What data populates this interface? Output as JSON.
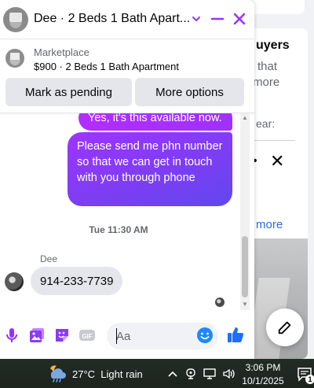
{
  "background": {
    "card_title": "uyers",
    "card_line1": "that",
    "card_line2": "more",
    "card_line3": "ear:",
    "card_dots": "•",
    "card_close": "✕",
    "card_link": "more"
  },
  "chat": {
    "title": "Dee · 2 Beds 1 Bath Apart...",
    "accent_color": "#9b30ff",
    "marketplace": {
      "label": "Marketplace",
      "listing": "$900 · 2 Beds 1 Bath Apartment"
    },
    "actions": {
      "mark_pending": "Mark as pending",
      "more_options": "More options"
    },
    "messages": [
      {
        "direction": "outgoing",
        "text": "Yes, it's this available now."
      },
      {
        "direction": "outgoing",
        "text": "Please send me  phn number so that we can get in touch with you through phone"
      }
    ],
    "timestamp": "Tue 11:30 AM",
    "incoming": {
      "sender": "Dee",
      "text": "914-233-7739"
    },
    "composer": {
      "placeholder": "Aa"
    }
  },
  "taskbar": {
    "temperature": "27°C",
    "weather": "Light rain",
    "time": "3:06 PM",
    "date": "10/1/2025",
    "notification_count": "1"
  }
}
